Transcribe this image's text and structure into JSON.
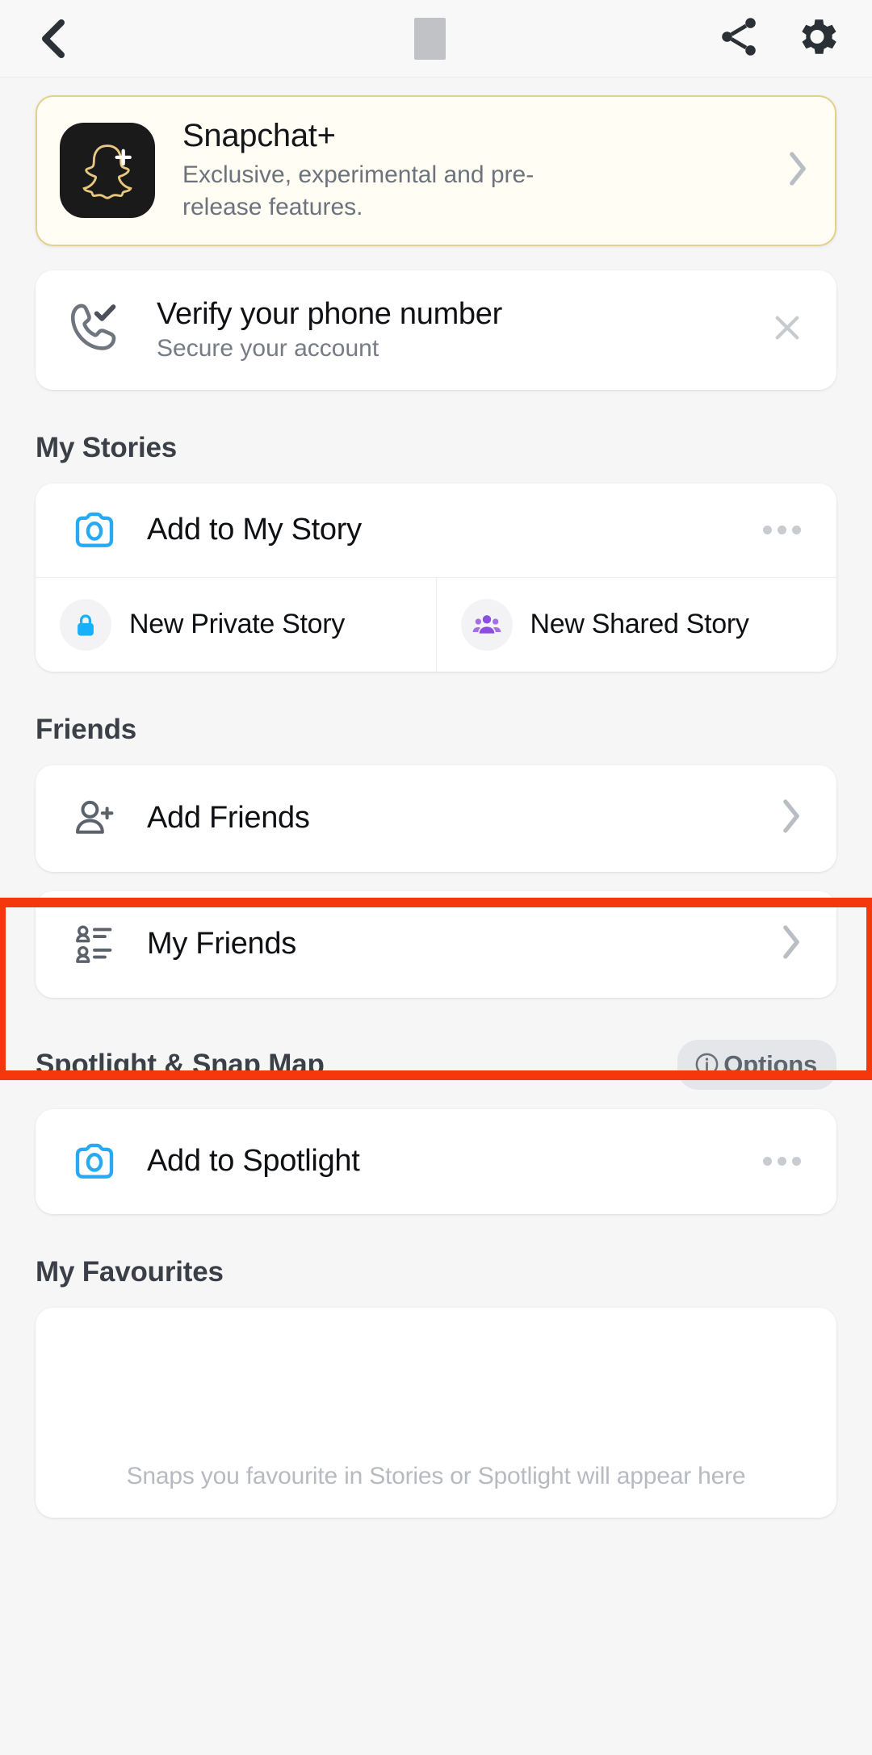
{
  "topbar": {
    "back_icon": "chevron-left-icon",
    "title_redacted": true,
    "share_icon": "share-icon",
    "settings_icon": "gear-icon"
  },
  "promo": {
    "icon": "snapchat-plus-ghost-icon",
    "title": "Snapchat+",
    "subtitle": "Exclusive, experimental and pre-release features.",
    "chevron": "chevron-right-icon",
    "border_color": "#e3d08a"
  },
  "verify": {
    "icon": "phone-check-icon",
    "title": "Verify your phone number",
    "subtitle": "Secure your account",
    "close_icon": "close-icon"
  },
  "stories": {
    "heading": "My Stories",
    "add_label": "Add to My Story",
    "add_icon": "camera-icon",
    "add_more_icon": "more-dots-icon",
    "private_label": "New Private Story",
    "private_icon": "lock-icon",
    "shared_label": "New Shared Story",
    "shared_icon": "group-icon",
    "accent_color": "#29a9f2",
    "shared_color": "#8d4de0"
  },
  "friends": {
    "heading": "Friends",
    "add_label": "Add Friends",
    "add_icon": "person-add-icon",
    "my_label": "My Friends",
    "my_icon": "friends-list-icon",
    "chevron": "chevron-right-icon"
  },
  "spotlight": {
    "heading": "Spotlight & Snap Map",
    "options_label": "Options",
    "options_icon": "info-icon",
    "add_label": "Add to Spotlight",
    "add_icon": "camera-icon",
    "more_icon": "more-dots-icon"
  },
  "favourites": {
    "heading": "My Favourites",
    "empty_text": "Snaps you favourite in Stories or Spotlight will appear here"
  },
  "annotation": {
    "color": "#f4380c",
    "target": "add-friends-row"
  }
}
